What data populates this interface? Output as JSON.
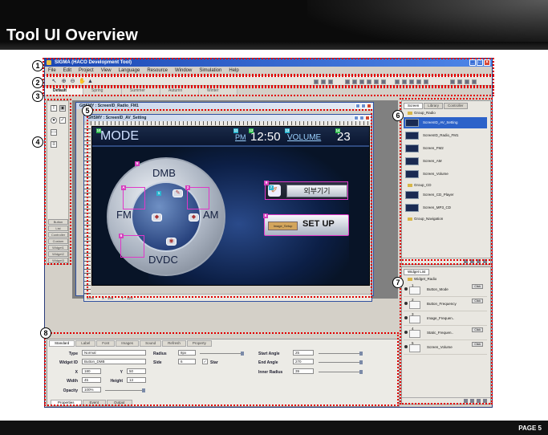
{
  "slide": {
    "title": "Tool UI Overview",
    "page_label": "PAGE 5"
  },
  "app": {
    "window_title": "SIGMA (HACO Development Tool)",
    "menu": [
      "File",
      "Edit",
      "Project",
      "View",
      "Language",
      "Resource",
      "Window",
      "Simulation",
      "Help"
    ],
    "tabs": [
      "Default",
      "Spring",
      "Summer",
      "Autumn",
      "Winter"
    ],
    "widget_categories": [
      "Button",
      "List",
      "Controller",
      "Custom",
      "Widget1",
      "Widget2",
      "Widget3"
    ]
  },
  "design": {
    "doc1_title": "GHSMY : ScreenID_Radio_FM1",
    "doc2_title": "GHSMY : ScreenID_AV_Setting",
    "status": [
      "40%",
      "X : 156",
      "Y : 123"
    ],
    "screen": {
      "mode": "MODE",
      "pm": "PM",
      "time": "12:50",
      "volume_label": "VOLUME",
      "volume_value": "23",
      "dial": {
        "top": "DMB",
        "left": "FM",
        "right": "AM",
        "bottom": "DVDC"
      },
      "external_button": "외부기기",
      "setup_small": "Image_Setup",
      "setup_button": "SET UP"
    }
  },
  "resources": {
    "tabs": [
      "Screen",
      "Library",
      "Controller"
    ],
    "groups": [
      {
        "name": "Group_Radio",
        "items": [
          "ScreenID_AV_Setting",
          "ScreenID_Radio_FM1",
          "Screen_FM2",
          "Screen_AM",
          "Screen_Volume"
        ]
      },
      {
        "name": "Group_CD",
        "items": [
          "Screen_CD_Player",
          "Screen_MP3_CD"
        ]
      },
      {
        "name": "Group_Navigation",
        "items": []
      }
    ]
  },
  "widget_list": {
    "title": "Widget List",
    "group": "Widget_Radio",
    "rows": [
      {
        "num": "1",
        "name": "Button_Mode"
      },
      {
        "num": "2",
        "name": "Button_Frequency"
      },
      {
        "num": "3",
        "name": "Image_Frequen.."
      },
      {
        "num": "4",
        "name": "Static_Frequen.."
      },
      {
        "num": "5",
        "name": "Screen_Volume"
      }
    ],
    "click_label": "Click"
  },
  "properties": {
    "tabs": [
      "Standard",
      "Label",
      "Font",
      "Images",
      "Sound",
      "Refresh",
      "Property"
    ],
    "bottom_tabs": [
      "Properties",
      "Event",
      "Output"
    ],
    "type_label": "Type",
    "type_value": "Normal",
    "widget_id_label": "Widget ID",
    "widget_id_value": "Button_DMB",
    "x_label": "X",
    "x_value": "180",
    "y_label": "Y",
    "y_value": "50",
    "width_label": "Width",
    "width_value": "45",
    "height_label": "Height",
    "height_value": "13",
    "opacity_label": "Opacity",
    "opacity_value": "100%",
    "radius_label": "Radius",
    "radius_value": "8px",
    "side_label": "Side",
    "side_value": "6",
    "star_label": "Star",
    "start_angle_label": "Start Angle",
    "start_angle_value": "25",
    "end_angle_label": "End Angle",
    "end_angle_value": "270",
    "inner_radius_label": "Inner Radius",
    "inner_radius_value": "39"
  },
  "callouts": [
    "1",
    "2",
    "3",
    "4",
    "5",
    "6",
    "7",
    "8"
  ],
  "colors": {
    "annotation": "#e10000",
    "title_bar": "#1b47b4",
    "selection": "#2c62c9"
  }
}
